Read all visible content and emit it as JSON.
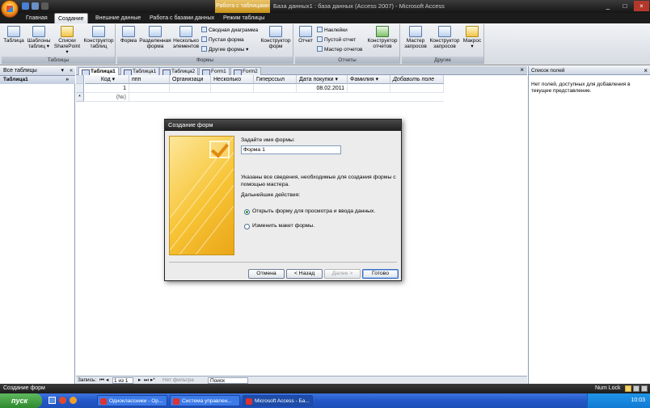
{
  "window": {
    "contextual_tab": "Работа с таблицами",
    "title": "База данных1 : база данных (Access 2007) - Microsoft Access"
  },
  "ribbon_tabs": [
    "Главная",
    "Создание",
    "Внешние данные",
    "Работа с базами данных",
    "Режим таблицы"
  ],
  "ribbon": {
    "tables": {
      "label": "Таблицы",
      "table": "Таблица",
      "templates": [
        "Шаблоны",
        "таблиц ▾"
      ],
      "sharepoint": [
        "Списки",
        "SharePoint ▾"
      ],
      "designer": [
        "Конструктор",
        "таблиц"
      ]
    },
    "forms": {
      "label": "Формы",
      "form": "Форма",
      "split": [
        "Разделенная",
        "форма"
      ],
      "multiple": [
        "Несколько",
        "элементов"
      ],
      "pivot_chart": "Сводная диаграмма",
      "blank_form": "Пустая форма",
      "other_forms": "Другие формы ▾",
      "designer": [
        "Конструктор",
        "форм"
      ]
    },
    "reports": {
      "label": "Отчеты",
      "report": "Отчет",
      "labels": "Наклейки",
      "blank_report": "Пустой отчет",
      "wizard": "Мастер отчетов",
      "designer": [
        "Конструктор",
        "отчетов"
      ]
    },
    "other": {
      "label": "Другие",
      "query_wizard": [
        "Мастер",
        "запросов"
      ],
      "query_designer": [
        "Конструктор",
        "запросов"
      ],
      "macro": [
        "Макрос",
        "▾"
      ]
    }
  },
  "nav": {
    "header": "Все таблицы",
    "section": "Таблица1"
  },
  "doc_tabs": [
    "Таблица1",
    "Таблица1",
    "Таблица2",
    "Form1",
    "Form2"
  ],
  "table": {
    "columns": [
      "Код",
      "ппп",
      "Организаци",
      "Несколько",
      "Гиперссыл",
      "Дата покупки",
      "Фамилия",
      "Добавить поле"
    ],
    "row1": {
      "code": "1",
      "date": "08.02.2011"
    },
    "new_row": {
      "marker": "*",
      "code": "(№)"
    }
  },
  "record_nav": {
    "label": "Запись:",
    "position": "1 из 1",
    "filter": "Нет фильтра",
    "search": "Поиск"
  },
  "field_list": {
    "title": "Список полей",
    "message": "Нет полей, доступных для добавления в текущее представление."
  },
  "dialog": {
    "title": "Создание форм",
    "prompt": "Задайте имя формы:",
    "form_name": "Форма 1",
    "info_line1": "Указаны все сведения, необходимые для создания формы с",
    "info_line2": "помощью мастера.",
    "next_actions": "Дальнейшие действия:",
    "option_open": "Открыть форму для просмотра и ввода данных.",
    "option_modify": "Изменить макет формы.",
    "selected_option": "open",
    "buttons": {
      "cancel": "Отмена",
      "back": "< Назад",
      "next": "Далее >",
      "finish": "Готово"
    }
  },
  "status": {
    "left": "Создание форм",
    "numlock": "Num Lock"
  },
  "taskbar": {
    "start": "пуск",
    "tasks": [
      "Одноклассники - Op...",
      "Система управлен...",
      "Microsoft Access - Ба..."
    ],
    "clock": "10:03"
  }
}
